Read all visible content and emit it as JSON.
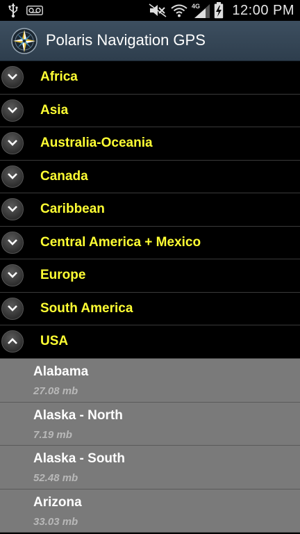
{
  "status_bar": {
    "time": "12:00 PM",
    "network_label": "4G",
    "icons": [
      "usb-icon",
      "voicemail-icon",
      "mute-icon",
      "wifi-icon",
      "signal-icon",
      "battery-charging-icon"
    ]
  },
  "action_bar": {
    "title": "Polaris Navigation GPS",
    "icon": "compass-rose-icon"
  },
  "groups": [
    {
      "label": "Africa",
      "expanded": false
    },
    {
      "label": "Asia",
      "expanded": false
    },
    {
      "label": "Australia-Oceania",
      "expanded": false
    },
    {
      "label": "Canada",
      "expanded": false
    },
    {
      "label": "Caribbean",
      "expanded": false
    },
    {
      "label": "Central America + Mexico",
      "expanded": false
    },
    {
      "label": "Europe",
      "expanded": false
    },
    {
      "label": "South America",
      "expanded": false
    },
    {
      "label": "USA",
      "expanded": true
    }
  ],
  "usa_items": [
    {
      "name": "Alabama",
      "size": "27.08 mb"
    },
    {
      "name": "Alaska - North",
      "size": "7.19 mb"
    },
    {
      "name": "Alaska - South",
      "size": "52.48 mb"
    },
    {
      "name": "Arizona",
      "size": "33.03 mb"
    }
  ],
  "colors": {
    "group_label": "#ffff33",
    "child_background": "#7a7a7a",
    "action_bar": "#34475a"
  }
}
